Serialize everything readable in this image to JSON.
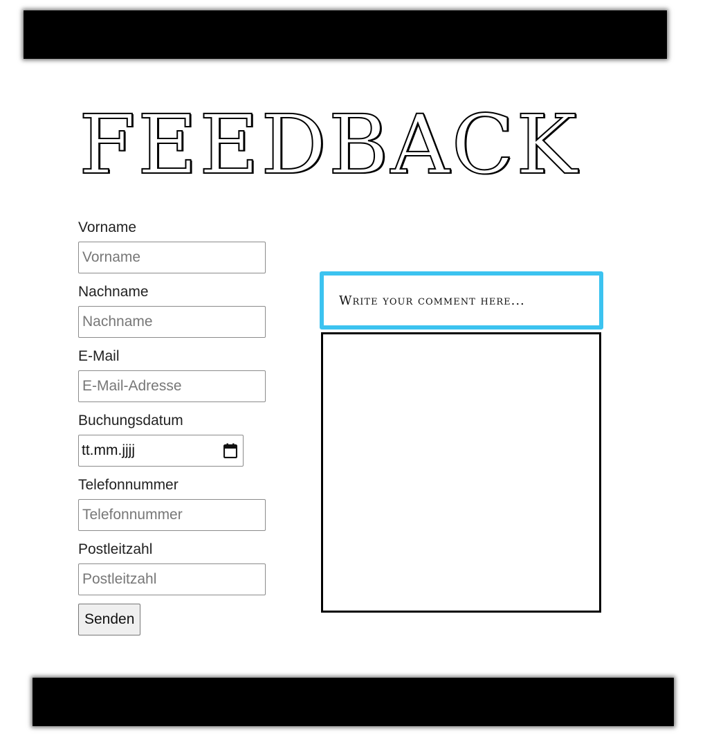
{
  "page": {
    "title": "FEEDBACK"
  },
  "form": {
    "fields": [
      {
        "label": "Vorname",
        "placeholder": "Vorname"
      },
      {
        "label": "Nachname",
        "placeholder": "Nachname"
      },
      {
        "label": "E-Mail",
        "placeholder": "E-Mail-Adresse"
      },
      {
        "label": "Buchungsdatum",
        "value": "tt.mm.jjjj"
      },
      {
        "label": "Telefonnummer",
        "placeholder": "Telefonnummer"
      },
      {
        "label": "Postleitzahl",
        "placeholder": "Postleitzahl"
      }
    ],
    "submit_label": "Senden"
  },
  "comment": {
    "header": "Write your comment here...",
    "value": ""
  },
  "colors": {
    "accent": "#3cc3f0",
    "bars": "#000000"
  },
  "icons": {
    "date_picker": "calendar-icon"
  }
}
